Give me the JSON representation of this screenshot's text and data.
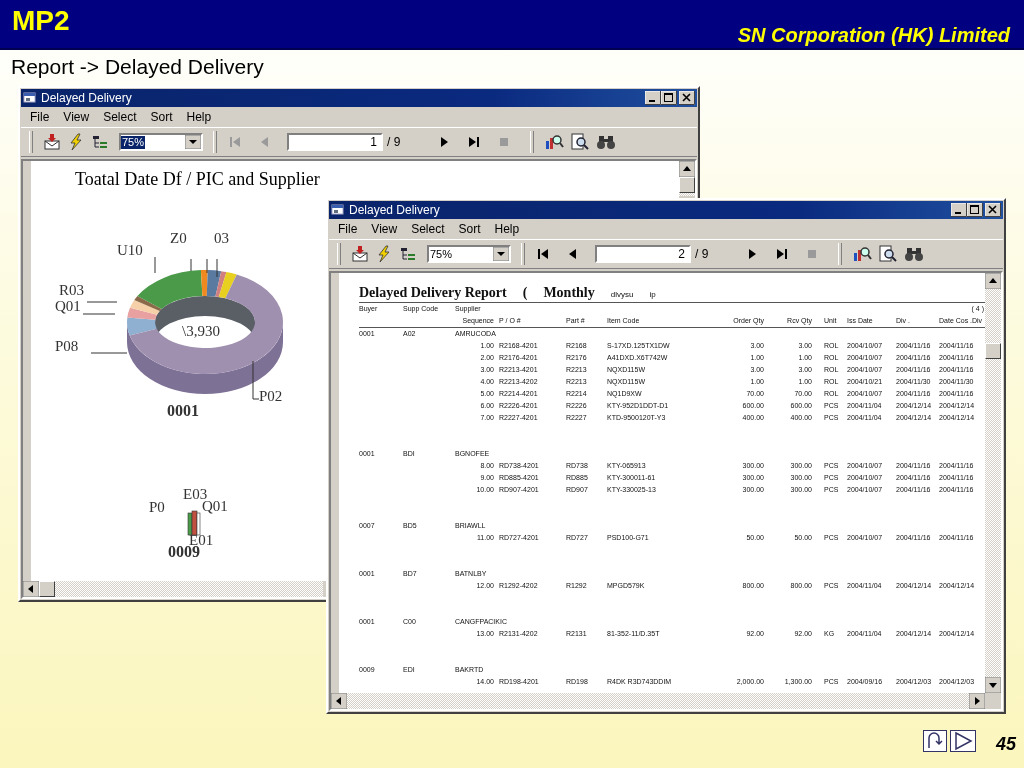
{
  "slide": {
    "logo": "MP2",
    "company": "SN Corporation (HK) Limited",
    "heading": "Report -> Delayed Delivery",
    "page_number": "45"
  },
  "windows": [
    {
      "title": "Delayed Delivery",
      "menu": [
        "File",
        "View",
        "Select",
        "Sort",
        "Help"
      ],
      "zoom": "75%",
      "zoom_selected": true,
      "page": "1",
      "page_total": "/ 9",
      "nav": [
        {
          "kind": "first",
          "disabled": true
        },
        {
          "kind": "prev",
          "disabled": true
        },
        {
          "kind": "next",
          "disabled": false
        },
        {
          "kind": "last",
          "disabled": false
        },
        {
          "kind": "stop",
          "disabled": true
        }
      ],
      "content": {
        "kind": "chart",
        "title": "Toatal Date Df / PIC and Supplier",
        "labels": [
          "U10",
          "Z0",
          "03",
          "R03",
          "Q01",
          "P08",
          "\\3,930",
          "P02"
        ],
        "caption": "0001",
        "mini_labels": [
          "E03",
          "P0",
          "Q01",
          "E01"
        ],
        "mini_caption": "0009"
      }
    },
    {
      "title": "Delayed Delivery",
      "menu": [
        "File",
        "View",
        "Select",
        "Sort",
        "Help"
      ],
      "zoom": "75%",
      "zoom_selected": false,
      "page": "2",
      "page_total": "/ 9",
      "nav": [
        {
          "kind": "first",
          "disabled": false
        },
        {
          "kind": "prev",
          "disabled": false
        },
        {
          "kind": "next",
          "disabled": false
        },
        {
          "kind": "last",
          "disabled": false
        },
        {
          "kind": "stop",
          "disabled": true
        }
      ],
      "content": {
        "kind": "report",
        "title": "Delayed Delivery Report",
        "open": "(",
        "period": "Monthly",
        "notes": [
          "dlvysu",
          "ip"
        ],
        "page_marker": "( 4 )",
        "header_top": [
          "Buyer",
          "Supp Code",
          "Supplier"
        ],
        "header_bottom": [
          "Sequence",
          "P / O #",
          "Part #",
          "Item Code",
          "Order Qty",
          "Rcv Qty",
          "Unit",
          "Iss Date",
          "Div .",
          "Date Cos .",
          "Div"
        ],
        "groups": [
          {
            "buyer": "0001",
            "supp_code": "A02",
            "supplier": "AMRUCODA",
            "rows": [
              [
                "1.00",
                "R2168-4201",
                "R2168",
                "S-17XD.125TX1DW",
                "3.00",
                "3.00",
                "ROL",
                "2004/10/07",
                "2004/11/16",
                "2004/11/16"
              ],
              [
                "2.00",
                "R2176-4201",
                "R2176",
                "A41DXD.X6T742W",
                "1.00",
                "1.00",
                "ROL",
                "2004/10/07",
                "2004/11/16",
                "2004/11/16"
              ],
              [
                "3.00",
                "R2213-4201",
                "R2213",
                "NQXD115W",
                "3.00",
                "3.00",
                "ROL",
                "2004/10/07",
                "2004/11/16",
                "2004/11/16"
              ],
              [
                "4.00",
                "R2213-4202",
                "R2213",
                "NQXD115W",
                "1.00",
                "1.00",
                "ROL",
                "2004/10/21",
                "2004/11/30",
                "2004/11/30"
              ],
              [
                "5.00",
                "R2214-4201",
                "R2214",
                "NQ1D9XW",
                "70.00",
                "70.00",
                "ROL",
                "2004/10/07",
                "2004/11/16",
                "2004/11/16"
              ],
              [
                "6.00",
                "R2226-4201",
                "R2226",
                "KTY-952D1DDT-D1",
                "600.00",
                "600.00",
                "PCS",
                "2004/11/04",
                "2004/12/14",
                "2004/12/14"
              ],
              [
                "7.00",
                "R2227-4201",
                "R2227",
                "KTD-9500120T-Y3",
                "400.00",
                "400.00",
                "PCS",
                "2004/11/04",
                "2004/12/14",
                "2004/12/14"
              ]
            ]
          },
          {
            "buyer": "0001",
            "supp_code": "BDI",
            "supplier": "BGNOFEE",
            "rows": [
              [
                "8.00",
                "RD738-4201",
                "RD738",
                "KTY-065913",
                "300.00",
                "300.00",
                "PCS",
                "2004/10/07",
                "2004/11/16",
                "2004/11/16"
              ],
              [
                "9.00",
                "RD885-4201",
                "RD885",
                "KTY-300011-61",
                "300.00",
                "300.00",
                "PCS",
                "2004/10/07",
                "2004/11/16",
                "2004/11/16"
              ],
              [
                "10.00",
                "RD907-4201",
                "RD907",
                "KTY-330025-13",
                "300.00",
                "300.00",
                "PCS",
                "2004/10/07",
                "2004/11/16",
                "2004/11/16"
              ]
            ]
          },
          {
            "buyer": "0007",
            "supp_code": "BD5",
            "supplier": "BRIAWLL",
            "rows": [
              [
                "11.00",
                "RD727-4201",
                "RD727",
                "PSD100-G71",
                "50.00",
                "50.00",
                "PCS",
                "2004/10/07",
                "2004/11/16",
                "2004/11/16"
              ]
            ]
          },
          {
            "buyer": "0001",
            "supp_code": "BD7",
            "supplier": "BATNLBY",
            "rows": [
              [
                "12.00",
                "R1292-4202",
                "R1292",
                "MPGD579K",
                "800.00",
                "800.00",
                "PCS",
                "2004/11/04",
                "2004/12/14",
                "2004/12/14"
              ]
            ]
          },
          {
            "buyer": "0001",
            "supp_code": "C00",
            "supplier": "CANGFPACIKIC",
            "rows": [
              [
                "13.00",
                "R2131-4202",
                "R2131",
                "81-352-11/D.35T",
                "92.00",
                "92.00",
                "KG",
                "2004/11/04",
                "2004/12/14",
                "2004/12/14"
              ]
            ]
          },
          {
            "buyer": "0009",
            "supp_code": "EDI",
            "supplier": "BAKRTD",
            "rows": [
              [
                "14.00",
                "RD198-4201",
                "RD198",
                "R4DK R3D743DDIM",
                "2,000.00",
                "1,300.00",
                "PCS",
                "2004/09/16",
                "2004/12/03",
                "2004/12/03"
              ]
            ]
          }
        ]
      }
    }
  ]
}
